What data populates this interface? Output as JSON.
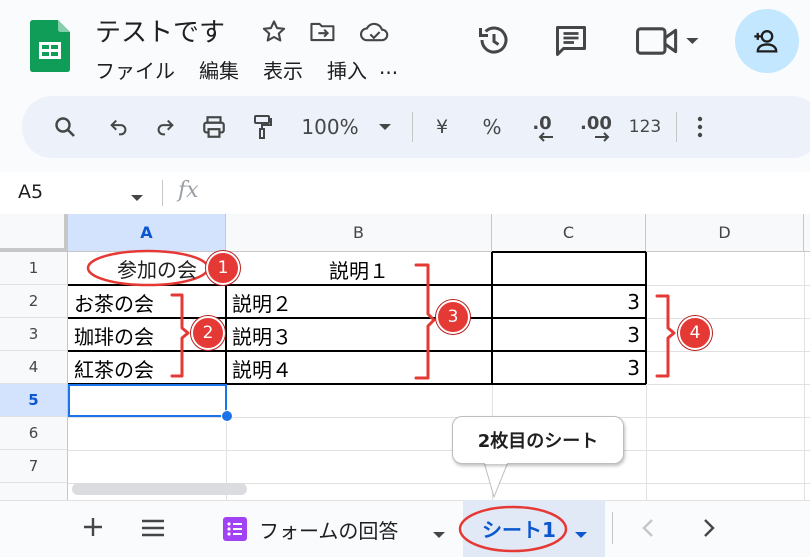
{
  "app": {
    "doc_title": "テストです",
    "menu": [
      "ファイル",
      "編集",
      "表示",
      "挿入",
      "..."
    ]
  },
  "icons": {
    "star": "star-icon",
    "move": "folder-move-icon",
    "cloud": "cloud-saved-icon",
    "history": "history-icon",
    "comments": "comments-icon",
    "meet": "video-call-icon",
    "share": "add-person-icon"
  },
  "toolbar": {
    "zoom": "100%",
    "currency": "¥",
    "percent": "%",
    "decrease_decimal": ".0",
    "increase_decimal": ".00",
    "number_format": "123"
  },
  "formula_bar": {
    "name_box": "A5",
    "fx": "fx",
    "value": ""
  },
  "grid": {
    "columns": [
      "A",
      "B",
      "C",
      "D"
    ],
    "rows": [
      "1",
      "2",
      "3",
      "4",
      "5",
      "6",
      "7"
    ],
    "active_row": "5",
    "cells": {
      "A1": "参加の会",
      "B1": "説明１",
      "A2": "お茶の会",
      "B2": "説明２",
      "C2": "3",
      "A3": "珈琲の会",
      "B3": "説明３",
      "C3": "3",
      "A4": "紅茶の会",
      "B4": "説明４",
      "C4": "3"
    }
  },
  "annotations": {
    "badges": [
      "1",
      "2",
      "3",
      "4"
    ],
    "callout": "2枚目のシート",
    "color": "#e53935"
  },
  "sheet_tabs": {
    "form_tab": "フォームの回答",
    "active_tab": "シート1"
  },
  "colors": {
    "selection": "#1a73e8",
    "active_tab_bg": "#e1e9f7",
    "active_tab_text": "#0b57d0",
    "form_icon": "#a142f4"
  }
}
